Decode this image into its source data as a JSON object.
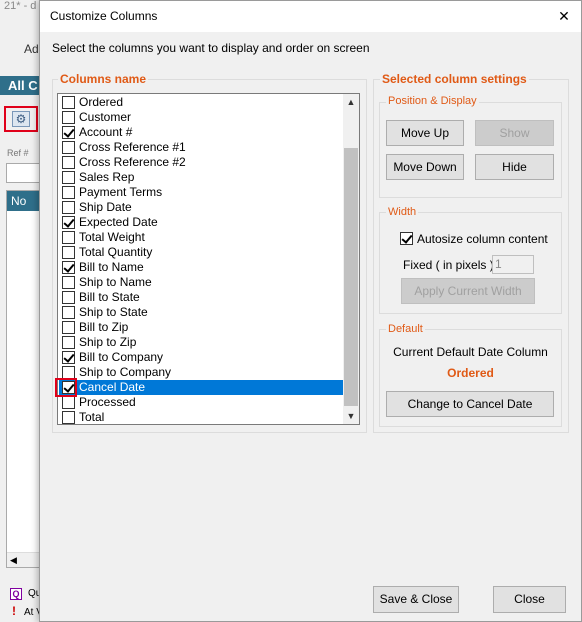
{
  "background": {
    "title_fragment": "21* - d",
    "toolbar_fragment": "Ad",
    "tab_fragment": "All C",
    "ref_label": "Ref #",
    "grid_header": "No",
    "legend_q_icon": "Q",
    "legend_q_text": "Qu",
    "legend_i_text": "At V"
  },
  "dialog": {
    "title": "Customize Columns",
    "close_glyph": "✕",
    "instruction": "Select the columns you want to display and order on screen",
    "columns_group_label": "Columns name",
    "columns": [
      {
        "label": "Ordered",
        "checked": false,
        "selected": false
      },
      {
        "label": "Customer",
        "checked": false,
        "selected": false
      },
      {
        "label": "Account #",
        "checked": true,
        "selected": false
      },
      {
        "label": "Cross Reference #1",
        "checked": false,
        "selected": false
      },
      {
        "label": "Cross Reference #2",
        "checked": false,
        "selected": false
      },
      {
        "label": "Sales Rep",
        "checked": false,
        "selected": false
      },
      {
        "label": "Payment Terms",
        "checked": false,
        "selected": false
      },
      {
        "label": "Ship Date",
        "checked": false,
        "selected": false
      },
      {
        "label": "Expected Date",
        "checked": true,
        "selected": false
      },
      {
        "label": "Total Weight",
        "checked": false,
        "selected": false
      },
      {
        "label": "Total Quantity",
        "checked": false,
        "selected": false
      },
      {
        "label": "Bill to Name",
        "checked": true,
        "selected": false
      },
      {
        "label": "Ship to Name",
        "checked": false,
        "selected": false
      },
      {
        "label": "Bill to State",
        "checked": false,
        "selected": false
      },
      {
        "label": "Ship to State",
        "checked": false,
        "selected": false
      },
      {
        "label": "Bill to Zip",
        "checked": false,
        "selected": false
      },
      {
        "label": "Ship to Zip",
        "checked": false,
        "selected": false
      },
      {
        "label": "Bill to Company",
        "checked": true,
        "selected": false
      },
      {
        "label": "Ship to Company",
        "checked": false,
        "selected": false
      },
      {
        "label": "Cancel Date",
        "checked": true,
        "selected": true
      },
      {
        "label": "Processed",
        "checked": false,
        "selected": false
      },
      {
        "label": "Total",
        "checked": false,
        "selected": false
      }
    ],
    "settings_group_label": "Selected column settings",
    "position_group_label": "Position & Display",
    "buttons": {
      "move_up": "Move Up",
      "show": "Show",
      "move_down": "Move Down",
      "hide": "Hide",
      "apply_width": "Apply Current Width",
      "change_default": "Change to Cancel Date",
      "save_close": "Save & Close",
      "close": "Close"
    },
    "width_group_label": "Width",
    "autosize_label": "Autosize column content",
    "autosize_checked": true,
    "fixed_label": "Fixed ( in pixels )",
    "fixed_value": "1",
    "default_group_label": "Default",
    "current_default_label": "Current Default Date Column",
    "current_default_value": "Ordered",
    "colors": {
      "accent_orange": "#e05a16",
      "selection_blue": "#0078d7",
      "highlight_red": "#e0001a",
      "header_teal": "#2f6f8a"
    }
  }
}
